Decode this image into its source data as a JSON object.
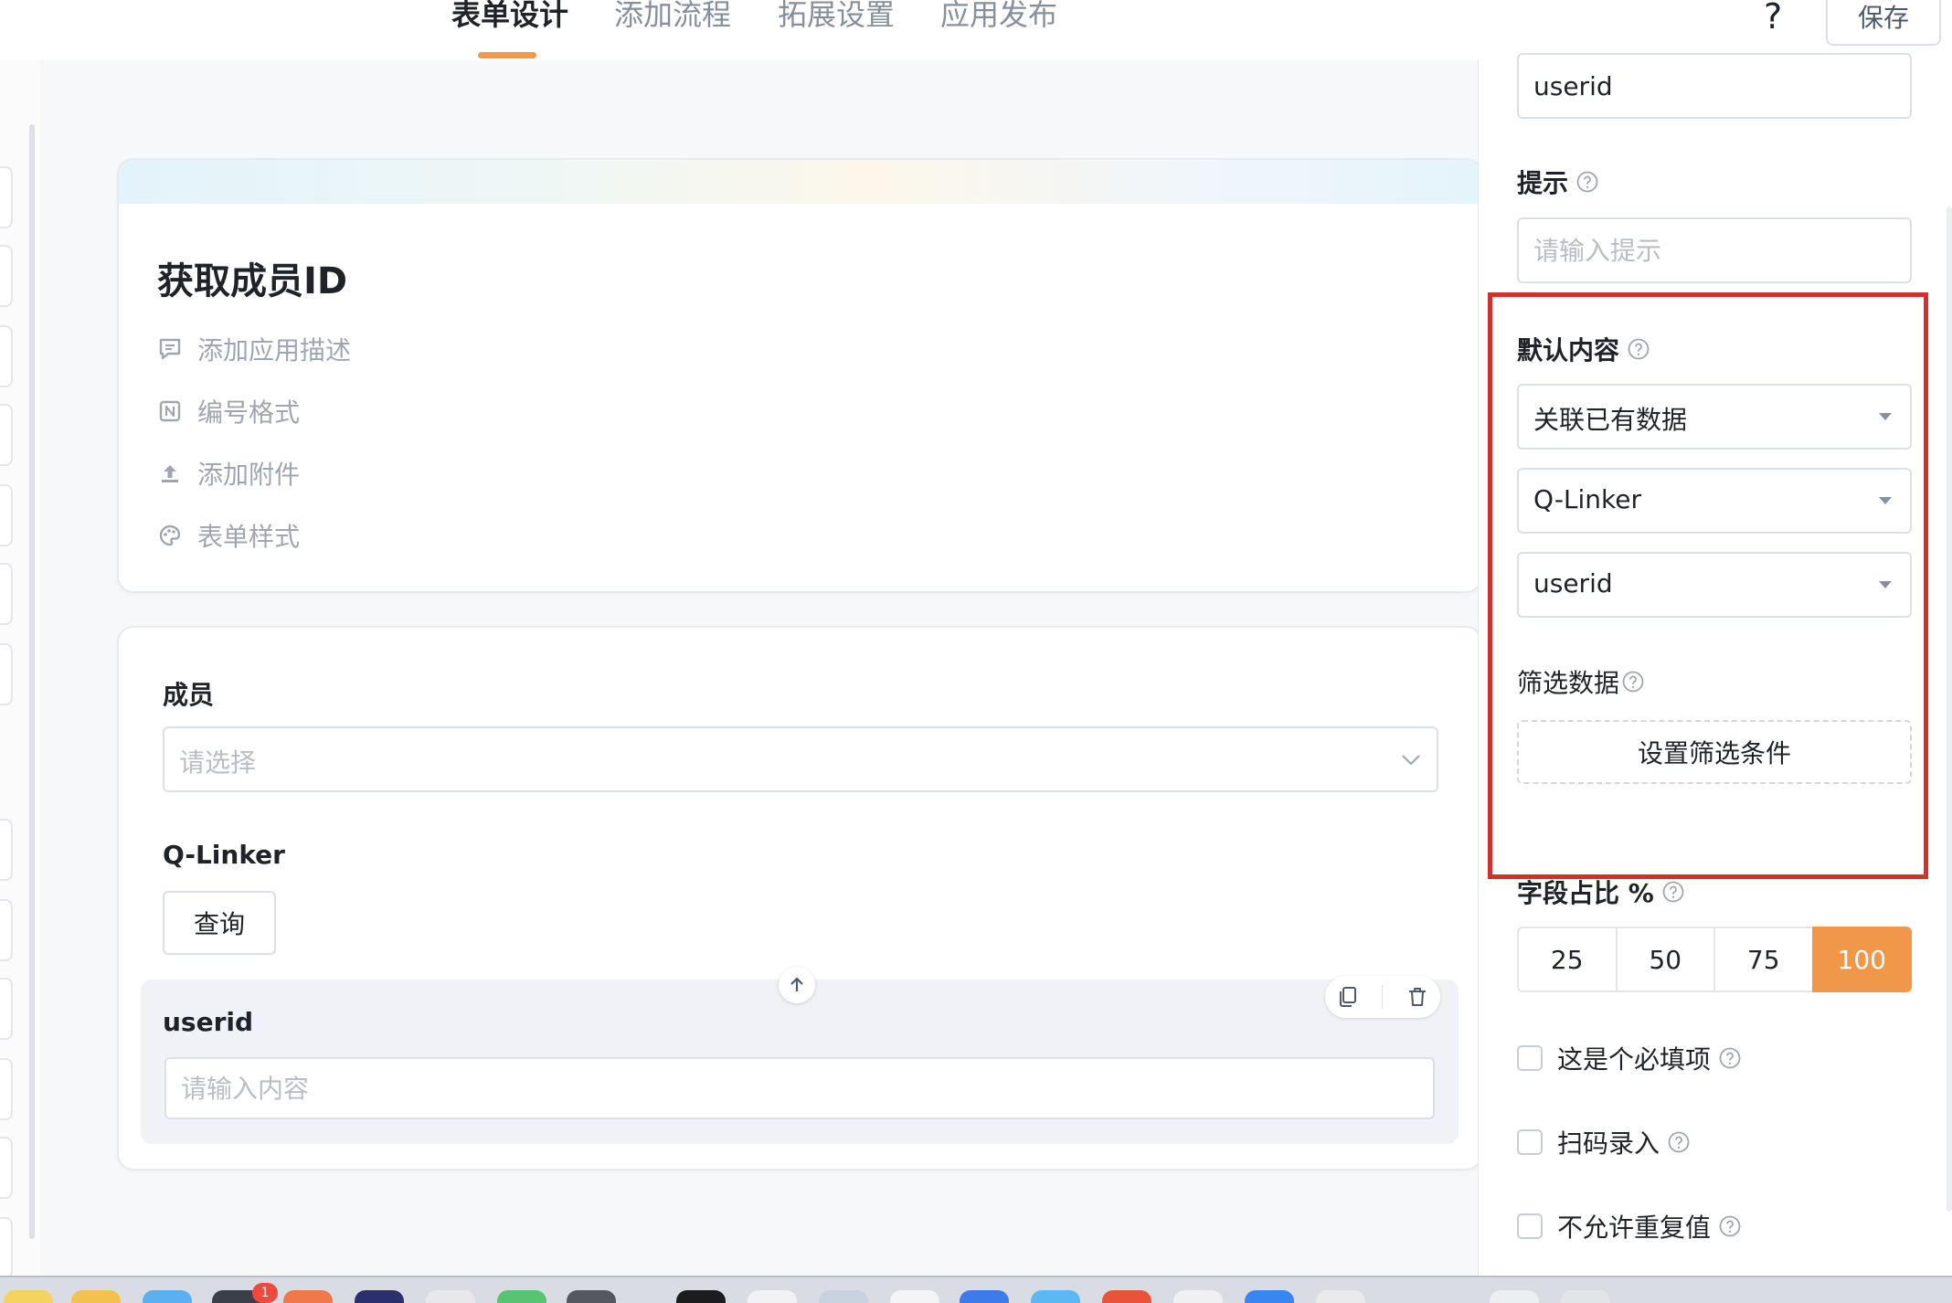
{
  "topbar": {
    "tabs": [
      {
        "label": "表单设计",
        "active": true
      },
      {
        "label": "添加流程",
        "active": false
      },
      {
        "label": "拓展设置",
        "active": false
      },
      {
        "label": "应用发布",
        "active": false
      }
    ],
    "help_label": "?",
    "save_label": "保存",
    "accent_color": "#f2994a"
  },
  "form_header": {
    "title": "获取成员ID",
    "meta_items": [
      {
        "icon": "comment-icon",
        "label": "添加应用描述"
      },
      {
        "icon": "number-format-icon",
        "label": "编号格式"
      },
      {
        "icon": "upload-icon",
        "label": "添加附件"
      },
      {
        "icon": "palette-icon",
        "label": "表单样式"
      }
    ]
  },
  "form_body": {
    "member_label": "成员",
    "member_placeholder": "请选择",
    "qlinker_label": "Q-Linker",
    "query_label": "查询",
    "userid_label": "userid",
    "userid_placeholder": "请输入内容"
  },
  "right_panel": {
    "title_value": "userid",
    "hint_label": "提示",
    "hint_placeholder": "请输入提示",
    "default_label": "默认内容",
    "default_selects": [
      "关联已有数据",
      "Q-Linker",
      "userid"
    ],
    "filter_label": "筛选数据",
    "filter_button": "设置筛选条件",
    "ratio_label": "字段占比 %",
    "ratio_options": [
      "25",
      "50",
      "75",
      "100"
    ],
    "ratio_selected": "100",
    "checks": [
      {
        "label": "这是个必填项",
        "checked": false
      },
      {
        "label": "扫码录入",
        "checked": false
      },
      {
        "label": "不允许重复值",
        "checked": false
      }
    ],
    "highlight_color": "#d2302a"
  },
  "dock": {
    "badge": "1"
  }
}
